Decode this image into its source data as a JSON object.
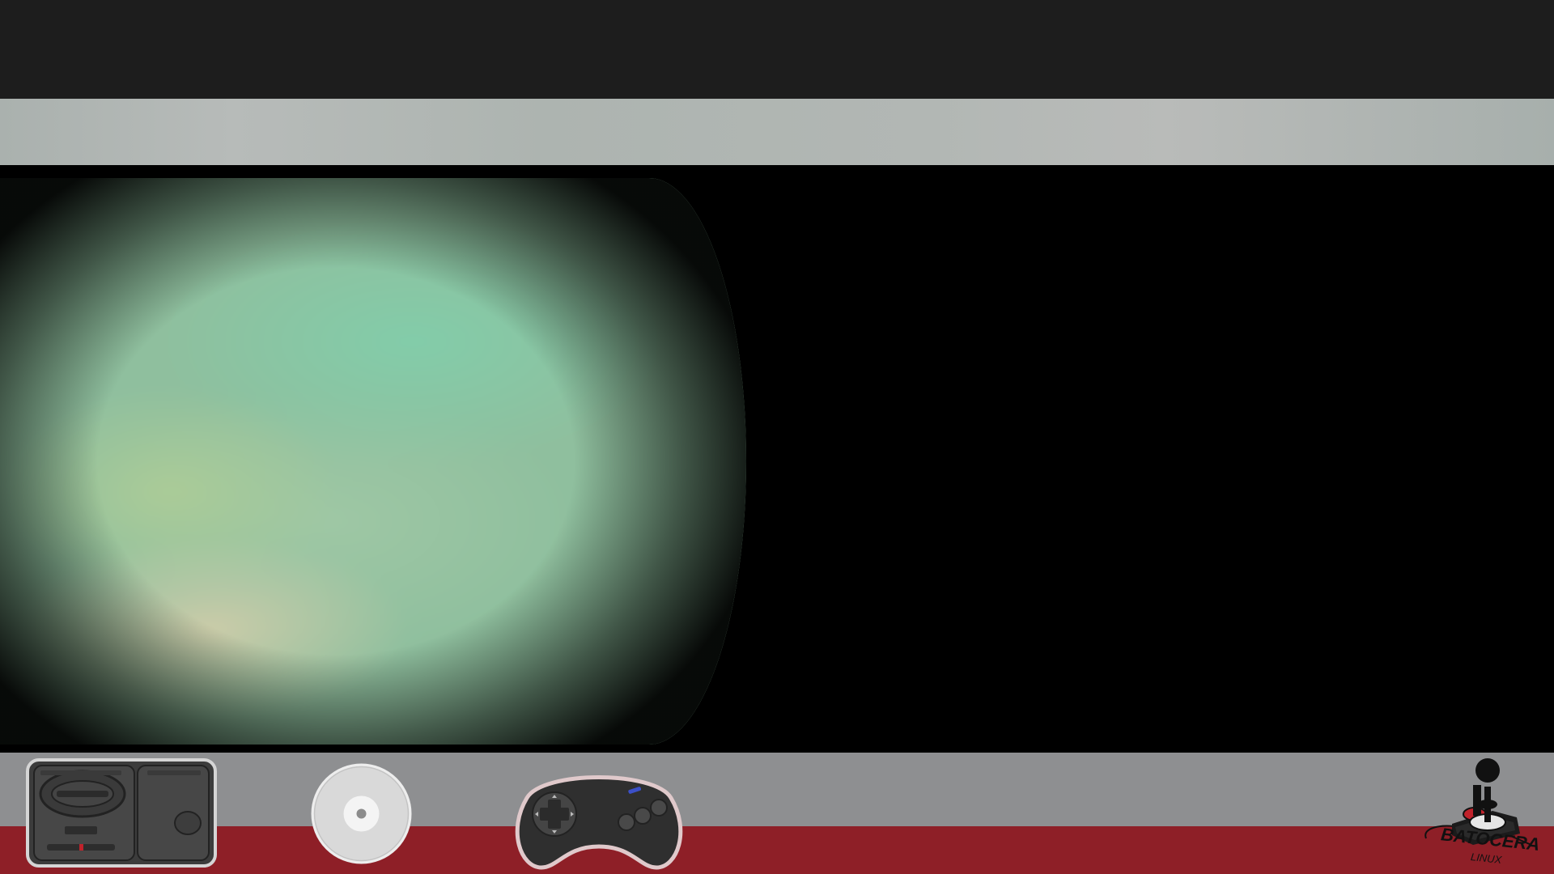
{
  "icons": {
    "system": "megadrive-console-icon",
    "media": "cd-disc-icon",
    "controller": "megadrive-gamepad-icon",
    "joystick": "joystick-icon"
  },
  "logo": {
    "title": "BATOCERA",
    "subtitle": "LINUX"
  },
  "colors": {
    "top_bar": "#1d1d1d",
    "header_band": "#adb4b0",
    "footer_gray": "#8e8f91",
    "footer_red": "#8e1f27",
    "screenshot_tint": "#8fbf9e"
  }
}
